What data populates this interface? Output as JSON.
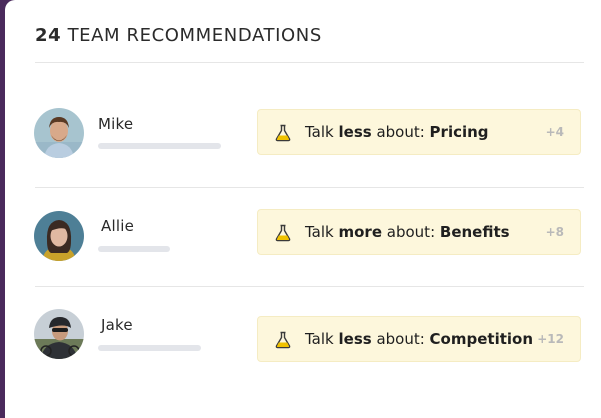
{
  "header": {
    "count": "24",
    "title": "TEAM RECOMMENDATIONS"
  },
  "icons": {
    "recommendation": "flask-icon"
  },
  "colors": {
    "recommendation_bg": "#fdf7dc",
    "flask": "#f0c200"
  },
  "rows": [
    {
      "name": "Mike",
      "rec": {
        "prefix": "Talk ",
        "emphasis": "less",
        "middle": " about: ",
        "topic": "Pricing"
      },
      "delta": "+4",
      "progress": 0.6
    },
    {
      "name": "Allie",
      "rec": {
        "prefix": "Talk ",
        "emphasis": "more",
        "middle": " about: ",
        "topic": "Benefits"
      },
      "delta": "+8",
      "progress": 0.35
    },
    {
      "name": "Jake",
      "rec": {
        "prefix": "Talk ",
        "emphasis": "less",
        "middle": " about: ",
        "topic": "Competition"
      },
      "delta": "+12",
      "progress": 0.55
    }
  ]
}
